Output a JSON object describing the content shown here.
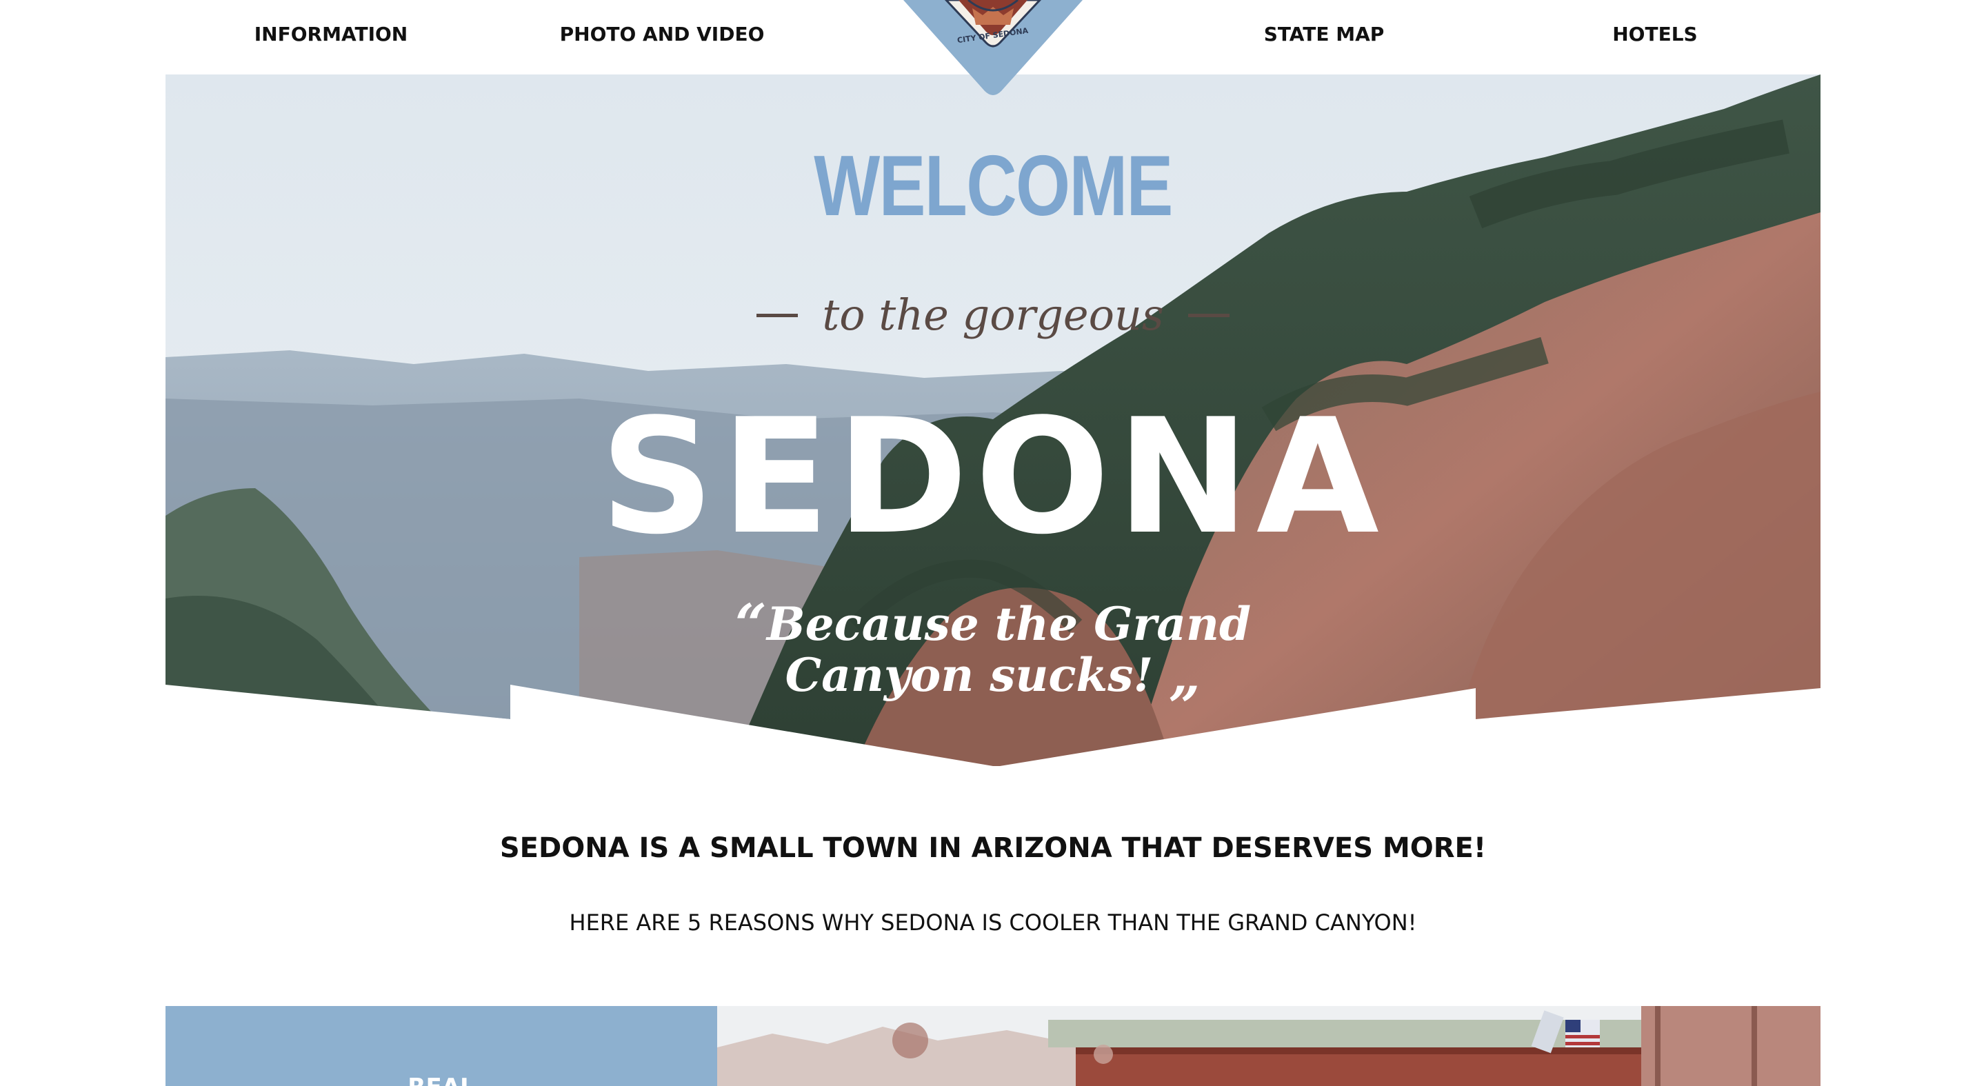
{
  "nav": {
    "items": [
      {
        "label": "INFORMATION"
      },
      {
        "label": "PHOTO AND VIDEO"
      },
      {
        "label": "STATE MAP"
      },
      {
        "label": "HOTELS"
      }
    ],
    "logo_text": "CITY OF SEDONA"
  },
  "hero": {
    "welcome": "WELCOME",
    "subtitle": "to the gorgeous",
    "title": "SEDONA",
    "quote_line1": "Because the Grand",
    "quote_line2": "Canyon sucks!",
    "quote_open": "“",
    "quote_close": "„"
  },
  "intro": {
    "headline": "SEDONA IS A SMALL TOWN IN ARIZONA THAT DESERVES MORE!",
    "subheadline": "HERE ARE 5 REASONS WHY SEDONA IS COOLER THAN THE GRAND CANYON!"
  },
  "reasons": {
    "first_label": "REAL"
  },
  "colors": {
    "accent_blue": "#8db0cf",
    "welcome_blue": "#7ea6cf",
    "text_brown": "#5a4a44"
  }
}
